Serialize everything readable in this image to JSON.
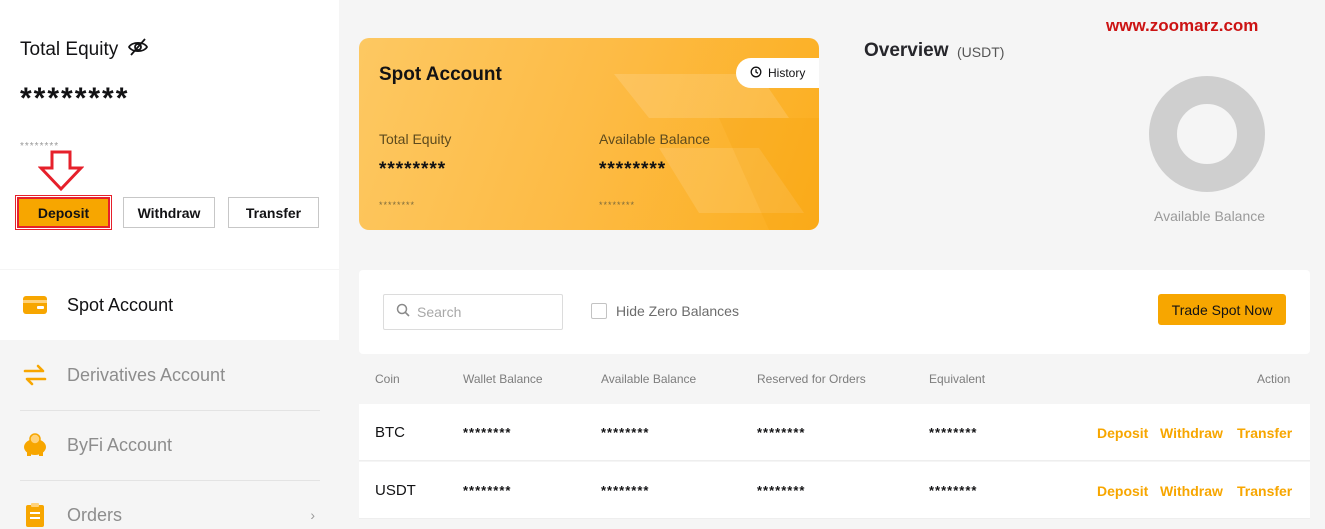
{
  "watermark": "www.zoomarz.com",
  "equity": {
    "title": "Total Equity",
    "value": "********",
    "sub_value": "********",
    "buttons": {
      "deposit": "Deposit",
      "withdraw": "Withdraw",
      "transfer": "Transfer"
    }
  },
  "nav": {
    "items": [
      {
        "label": "Spot Account",
        "icon": "wallet-card-icon",
        "active": true
      },
      {
        "label": "Derivatives Account",
        "icon": "swap-arrows-icon"
      },
      {
        "label": "ByFi Account",
        "icon": "piggy-bank-icon"
      },
      {
        "label": "Orders",
        "icon": "orders-list-icon"
      }
    ]
  },
  "spot_card": {
    "title": "Spot Account",
    "history_label": "History",
    "total_equity_label": "Total Equity",
    "total_equity_value": "********",
    "total_equity_sub": "********",
    "available_label": "Available Balance",
    "available_value": "********",
    "available_sub": "********"
  },
  "overview": {
    "title": "Overview",
    "unit": "(USDT)",
    "donut_label": "Available Balance"
  },
  "table_controls": {
    "search_placeholder": "Search",
    "hide_zero_label": "Hide Zero Balances",
    "trade_button": "Trade Spot Now"
  },
  "table": {
    "columns": [
      "Coin",
      "Wallet Balance",
      "Available Balance",
      "Reserved for Orders",
      "Equivalent",
      "Action"
    ],
    "rows": [
      {
        "coin": "BTC",
        "wallet": "********",
        "available": "********",
        "reserved": "********",
        "equivalent": "********"
      },
      {
        "coin": "USDT",
        "wallet": "********",
        "available": "********",
        "reserved": "********",
        "equivalent": "********"
      }
    ],
    "actions": {
      "deposit": "Deposit",
      "withdraw": "Withdraw",
      "transfer": "Transfer"
    }
  },
  "colors": {
    "accent": "#f7a600",
    "highlight_border": "#e6202b",
    "watermark": "#cc1313",
    "donut": "#cfcfcf"
  }
}
